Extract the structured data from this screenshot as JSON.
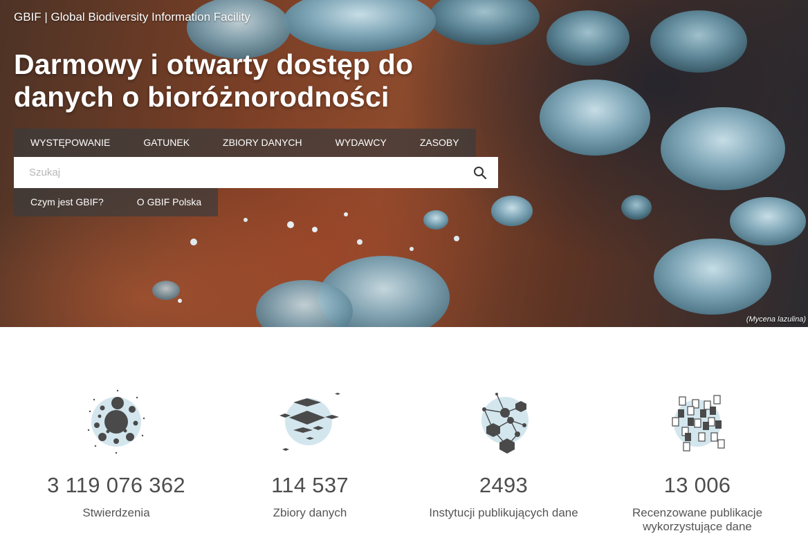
{
  "brand": "GBIF | Global Biodiversity Information Facility",
  "hero": {
    "headline": "Darmowy i otwarty dostęp do danych o bioróżnorodności",
    "caption": "(Mycena lazulina)"
  },
  "tabs": [
    {
      "label": "WYSTĘPOWANIE"
    },
    {
      "label": "GATUNEK"
    },
    {
      "label": "ZBIORY DANYCH"
    },
    {
      "label": "WYDAWCY"
    },
    {
      "label": "ZASOBY"
    }
  ],
  "search": {
    "placeholder": "Szukaj",
    "icon": "search-icon"
  },
  "sublinks": [
    {
      "label": "Czym jest GBIF?"
    },
    {
      "label": "O GBIF Polska"
    }
  ],
  "stats": [
    {
      "value": "3 119 076 362",
      "label": "Stwierdzenia",
      "icon": "occurrences-icon"
    },
    {
      "value": "114 537",
      "label": "Zbiory danych",
      "icon": "datasets-icon"
    },
    {
      "value": "2493",
      "label": "Instytucji publikujących dane",
      "icon": "publishers-icon"
    },
    {
      "value": "13 006",
      "label": "Recenzowane publikacje wykorzystujące dane",
      "icon": "publications-icon"
    }
  ],
  "colors": {
    "icon_circle": "#d3e6ee",
    "icon_dark": "#4a4a4a",
    "tab_bg": "rgba(60,60,60,0.72)"
  }
}
